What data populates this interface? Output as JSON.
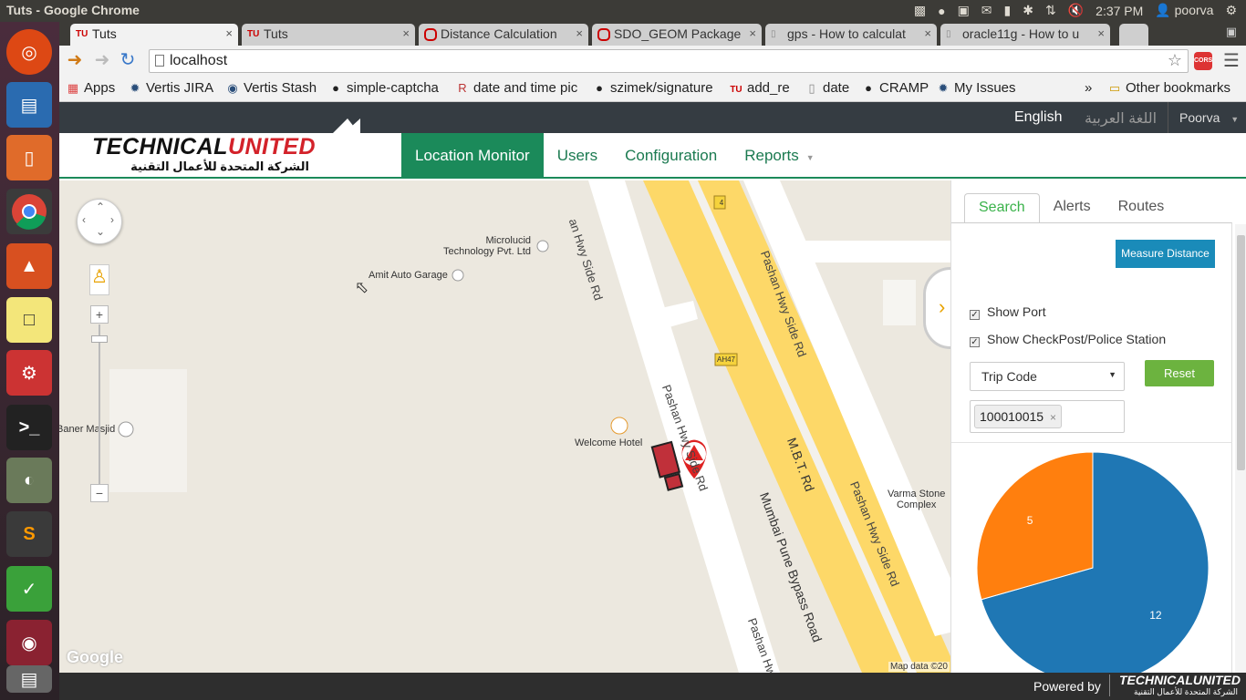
{
  "system": {
    "window_title": "Tuts - Google Chrome",
    "time": "2:37 PM",
    "user": "poorva"
  },
  "browser": {
    "tabs": [
      {
        "label": "Tuts"
      },
      {
        "label": "Tuts"
      },
      {
        "label": "Distance Calculation"
      },
      {
        "label": "SDO_GEOM Package"
      },
      {
        "label": "gps - How to calculat"
      },
      {
        "label": "oracle11g - How to u"
      }
    ],
    "url": "localhost",
    "bookmarks": [
      "Apps",
      "Vertis JIRA",
      "Vertis Stash",
      "simple-captcha",
      "date and time pic",
      "szimek/signature",
      "add_re",
      "date",
      "CRAMP",
      "My Issues"
    ],
    "more": "»",
    "other_bookmarks": "Other bookmarks",
    "ext_label": "CORS"
  },
  "app": {
    "lang_en": "English",
    "lang_ar": "اللغة العربية",
    "user_menu": "Poorva",
    "logo_en_a": "TECHNICAL",
    "logo_en_b": "UNITED",
    "logo_ar": "الشركة المتحدة للأعمال التقنية",
    "menu": [
      {
        "label": "Location Monitor"
      },
      {
        "label": "Users"
      },
      {
        "label": "Configuration"
      },
      {
        "label": "Reports"
      }
    ]
  },
  "map": {
    "poi": {
      "microlucid": "Microlucid\nTechnology Pvt. Ltd",
      "amit": "Amit Auto Garage",
      "masjid": "Baner Masjid",
      "hotel": "Welcome Hotel",
      "varma": "Varma Stone\nComplex"
    },
    "roads": {
      "r1": "Pashan Hwy Side Rd",
      "r2": "Pashan Hwy Side Rd",
      "r3": "Pashan Hwy Side Rd",
      "r4": "Pashan Hwy Side Rd",
      "r5": "Pashan Hwy Side Rd",
      "mbt": "M.B.T. Rd",
      "bypass": "Mumbai Pune Bypass Road",
      "top": "an Hwy Side Rd"
    },
    "shields": {
      "s4": "4",
      "ah47": "AH47"
    },
    "google": "Google",
    "attrib": "Map data ©20"
  },
  "panel": {
    "tabs": [
      {
        "label": "Search"
      },
      {
        "label": "Alerts"
      },
      {
        "label": "Routes"
      }
    ],
    "measure": "Measure Distance",
    "show_port": "Show Port",
    "show_checkpost": "Show CheckPost/Police Station",
    "trip_code": "Trip Code",
    "reset": "Reset",
    "tag": "100010015"
  },
  "chart_data": {
    "type": "pie",
    "categories": [
      "12",
      "5"
    ],
    "values": [
      12,
      5
    ],
    "colors": [
      "#1f77b4",
      "#ff7f0e"
    ]
  },
  "footer": {
    "powered": "Powered by"
  }
}
